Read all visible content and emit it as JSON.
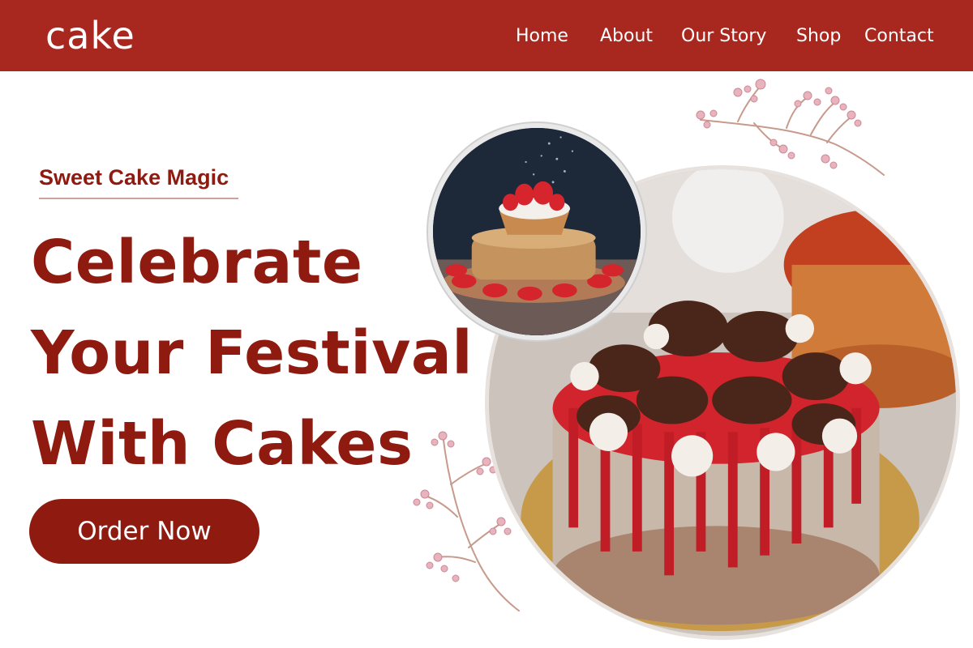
{
  "brand": {
    "logo": "cake",
    "color": "#a8281f",
    "accent": "#8e1a10"
  },
  "nav": {
    "links": [
      "Home",
      "About",
      "Our Story",
      "Shop",
      "Contact"
    ]
  },
  "hero": {
    "kicker": "Sweet Cake Magic",
    "headline": [
      "Celebrate",
      "Your Festival",
      "With Cakes"
    ],
    "cta_label": "Order Now"
  },
  "images": {
    "main": "chocolate-red-velvet-cake-photo",
    "inset": "strawberry-layer-pastry-photo",
    "decor": "pink-berry-branch-icon"
  }
}
